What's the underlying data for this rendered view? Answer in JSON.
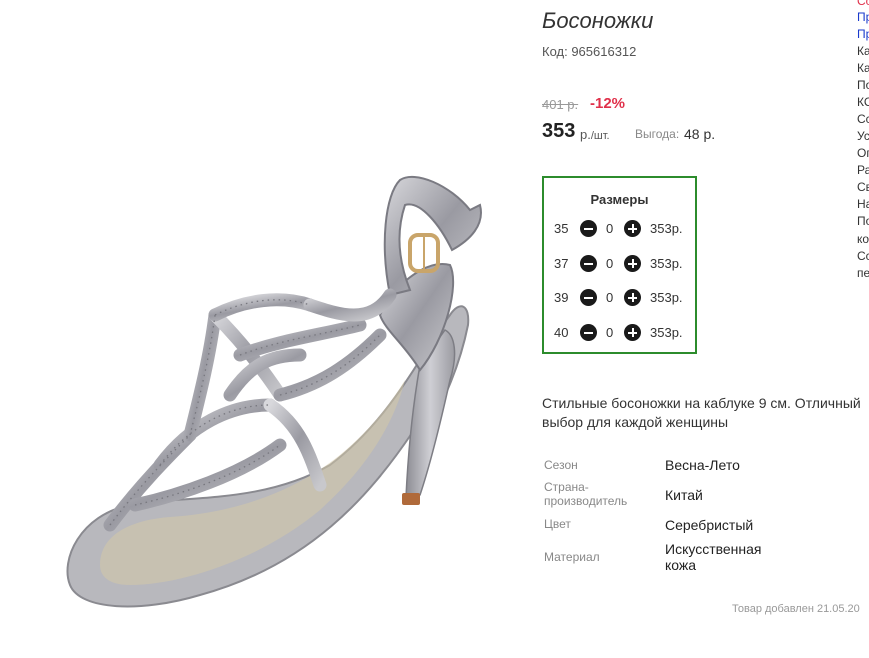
{
  "product": {
    "title": "Босоножки",
    "code": "Код: 965616312",
    "old_price": "401 р.",
    "discount": "-12%",
    "price": "353",
    "price_unit": "р.",
    "price_per": "/шт.",
    "saving_label": "Выгода:",
    "saving_value": "48 р.",
    "description": "Стильные босоножки на каблуке 9 см. Отличный выбор для каждой женщины",
    "added": "Товар добавлен 21.05.20"
  },
  "sizes": {
    "title": "Размеры",
    "rows": [
      {
        "size": "35",
        "qty": "0",
        "price": "353р."
      },
      {
        "size": "37",
        "qty": "0",
        "price": "353р."
      },
      {
        "size": "39",
        "qty": "0",
        "price": "353р."
      },
      {
        "size": "40",
        "qty": "0",
        "price": "353р."
      }
    ]
  },
  "specs": [
    {
      "label": "Сезон",
      "value": "Весна-Лето"
    },
    {
      "label": "Страна-производитель",
      "value": "Китай"
    },
    {
      "label": "Цвет",
      "value": "Серебристый"
    },
    {
      "label": "Материал",
      "value": "Искусственная кожа"
    }
  ],
  "side_menu": [
    "Сс",
    "Пр",
    "Пр",
    "Ка",
    "Ка",
    "По",
    "КС",
    "Сс",
    "Ус",
    "Ог",
    "Ра",
    "Св",
    "На",
    "По",
    "ко",
    "Сс",
    "пе"
  ],
  "colors": {
    "accent_red": "#e0304a",
    "box_border": "#2c8c2c",
    "link_blue": "#1a3acc"
  }
}
